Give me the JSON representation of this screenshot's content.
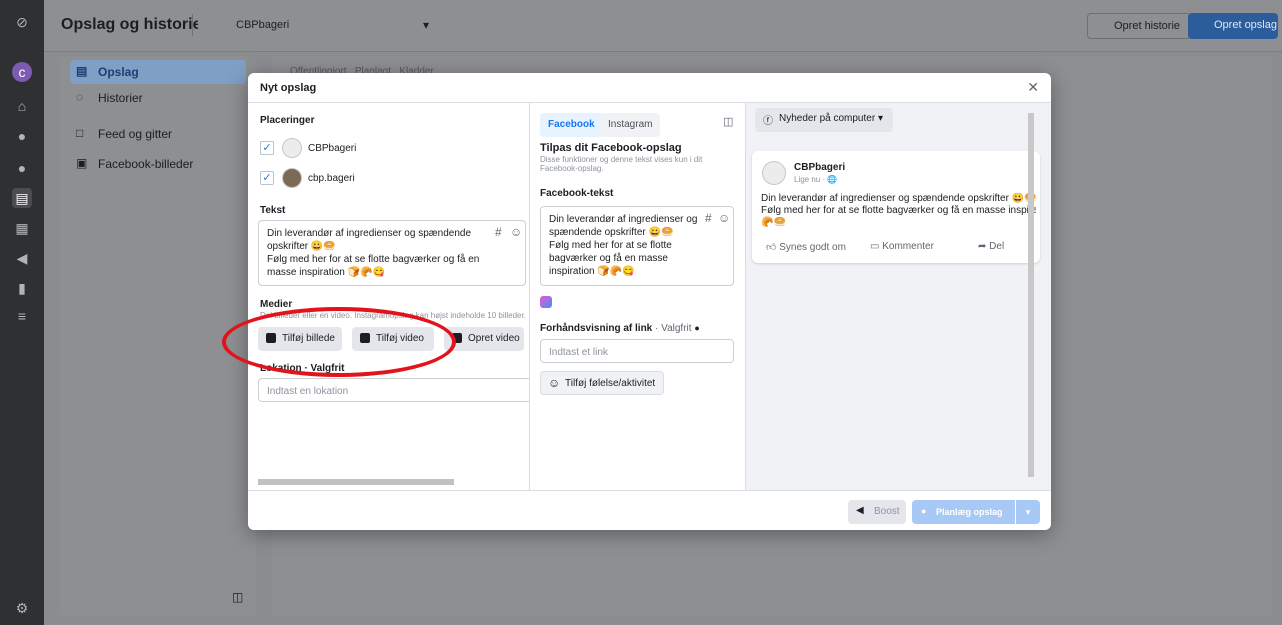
{
  "header": {
    "title": "Opslag og historier",
    "page_name": "CBPbageri",
    "create_story": "Opret historie",
    "create_post": "Opret opslag"
  },
  "sidebar": {
    "items": [
      {
        "label": "Opslag"
      },
      {
        "label": "Historier"
      },
      {
        "label": "Feed og gitter"
      },
      {
        "label": "Facebook-billeder"
      }
    ]
  },
  "background": {
    "tabs": [
      "Offentliggjort",
      "Planlagt",
      "Kladder"
    ]
  },
  "modal": {
    "title": "Nyt opslag",
    "placements": {
      "label": "Placeringer",
      "accounts": [
        {
          "name": "CBPbageri",
          "checked": true
        },
        {
          "name": "cbp.bageri",
          "checked": true
        }
      ]
    },
    "text": {
      "label": "Tekst",
      "value": "Din leverandør af ingredienser og spændende opskrifter 😀🥯\nFølg med her for at se flotte bagværker og få en masse inspiration 🍞🥐😋"
    },
    "media": {
      "label": "Medier",
      "hint": "Del billeder eller en video. Instagramopslag kan højst indeholde 10 billeder.",
      "add_photo": "Tilføj billede",
      "add_video": "Tilføj video",
      "create_video": "Opret video"
    },
    "location": {
      "label": "Lokation · Valgfrit",
      "placeholder": "Indtast en lokation"
    },
    "customize": {
      "tab_facebook": "Facebook",
      "tab_instagram": "Instagram",
      "title": "Tilpas dit Facebook-opslag",
      "subtitle": "Disse funktioner og denne tekst vises kun i dit Facebook-opslag.",
      "fb_text_label": "Facebook-tekst",
      "fb_text_value": "Din leverandør af ingredienser og spændende opskrifter 😀🥯\nFølg med her for at se flotte bagværker og få en masse inspiration 🍞🥐😋",
      "link_label": "Forhåndsvisning af link",
      "link_optional": " · Valgfrit",
      "link_placeholder": "Indtast et link",
      "feeling_button": "Tilføj følelse/aktivitet"
    },
    "preview": {
      "feed_selector": "Nyheder på computer",
      "page_name": "CBPbageri",
      "meta": "Lige nu · 🌐",
      "body_line1": "Din leverandør af ingredienser og spændende opskrifter 😀🥯",
      "body_line2": "Følg med her for at se flotte bagværker og få en masse inspiration",
      "body_line3": "🥐🥯",
      "like": "Synes godt om",
      "comment": "Kommenter",
      "share": "Del"
    },
    "footer": {
      "boost": "Boost",
      "schedule": "Planlæg opslag"
    }
  },
  "colors": {
    "accent": "#1877f2",
    "annotation": "#e2131c"
  }
}
